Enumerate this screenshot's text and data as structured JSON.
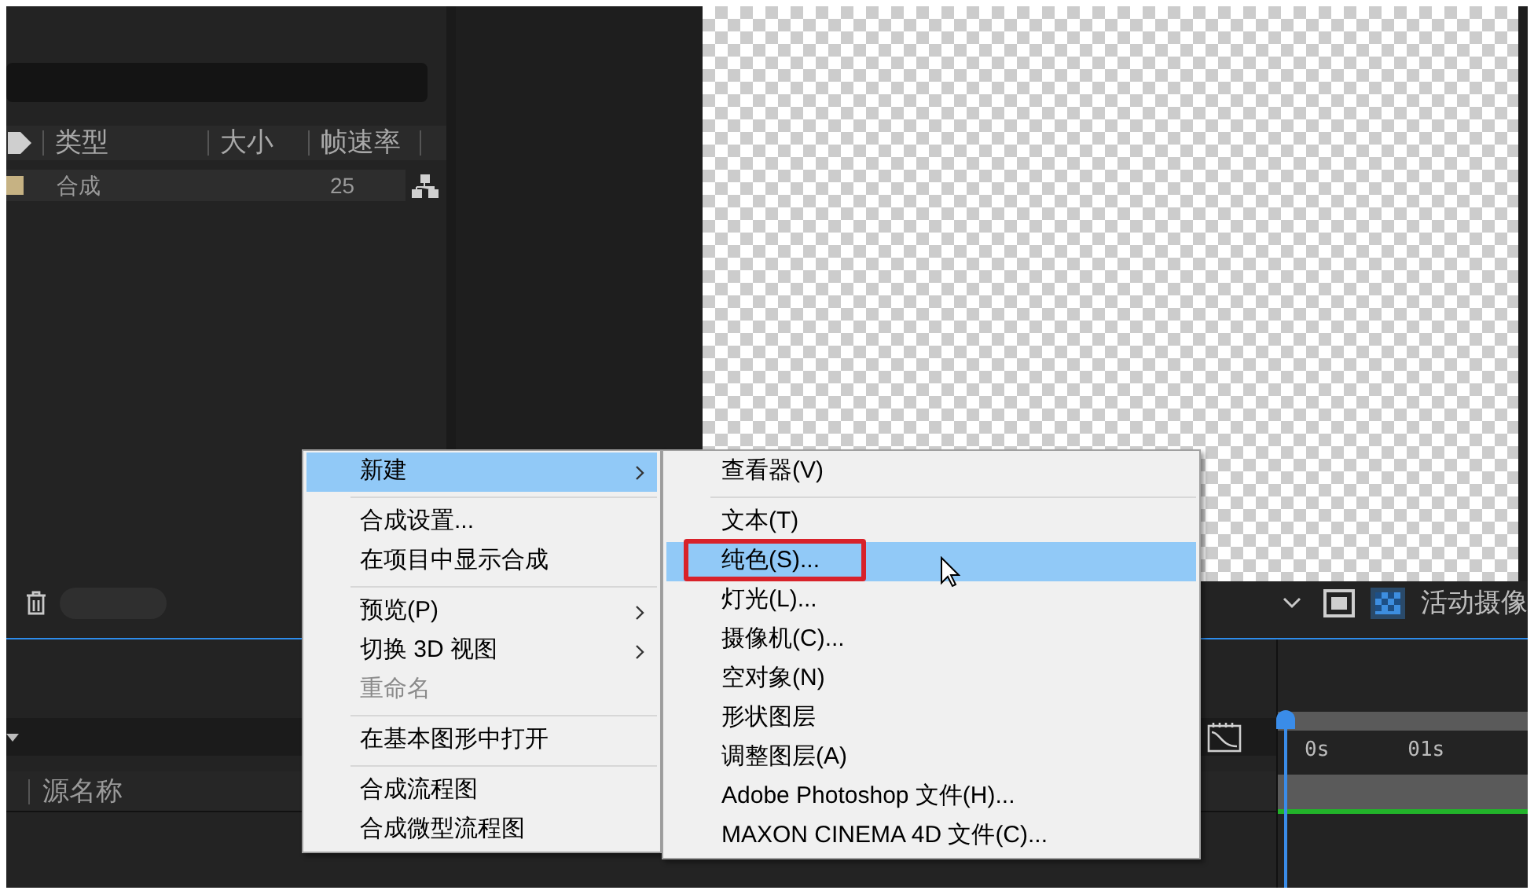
{
  "project_panel": {
    "columns": [
      {
        "label": "类型"
      },
      {
        "label": "大小"
      },
      {
        "label": "帧速率"
      }
    ],
    "rows": [
      {
        "type": "合成",
        "frame_rate": "25",
        "color": "#c6b283"
      }
    ]
  },
  "viewer_toolbar": {
    "camera_label": "活动摄像"
  },
  "timeline": {
    "column": "源名称",
    "ruler": [
      "0s",
      "01s"
    ]
  },
  "context_menu": {
    "items": [
      {
        "kind": "item",
        "label": "新建",
        "submenu": true,
        "selected": true,
        "disabled": false
      },
      {
        "kind": "separator"
      },
      {
        "kind": "item",
        "label": "合成设置...",
        "submenu": false,
        "selected": false,
        "disabled": false
      },
      {
        "kind": "item",
        "label": "在项目中显示合成",
        "submenu": false,
        "selected": false,
        "disabled": false
      },
      {
        "kind": "separator"
      },
      {
        "kind": "item",
        "label": "预览(P)",
        "submenu": true,
        "selected": false,
        "disabled": false
      },
      {
        "kind": "item",
        "label": "切换 3D 视图",
        "submenu": true,
        "selected": false,
        "disabled": false
      },
      {
        "kind": "item",
        "label": "重命名",
        "submenu": false,
        "selected": false,
        "disabled": true
      },
      {
        "kind": "separator"
      },
      {
        "kind": "item",
        "label": "在基本图形中打开",
        "submenu": false,
        "selected": false,
        "disabled": false
      },
      {
        "kind": "separator"
      },
      {
        "kind": "item",
        "label": "合成流程图",
        "submenu": false,
        "selected": false,
        "disabled": false
      },
      {
        "kind": "item",
        "label": "合成微型流程图",
        "submenu": false,
        "selected": false,
        "disabled": false
      }
    ]
  },
  "submenu": {
    "items": [
      {
        "kind": "item",
        "label": "查看器(V)",
        "selected": false,
        "annotated": false
      },
      {
        "kind": "separator"
      },
      {
        "kind": "item",
        "label": "文本(T)",
        "selected": false,
        "annotated": false
      },
      {
        "kind": "item",
        "label": "纯色(S)...",
        "selected": true,
        "annotated": true
      },
      {
        "kind": "item",
        "label": "灯光(L)...",
        "selected": false,
        "annotated": false
      },
      {
        "kind": "item",
        "label": "摄像机(C)...",
        "selected": false,
        "annotated": false
      },
      {
        "kind": "item",
        "label": "空对象(N)",
        "selected": false,
        "annotated": false
      },
      {
        "kind": "item",
        "label": "形状图层",
        "selected": false,
        "annotated": false
      },
      {
        "kind": "item",
        "label": "调整图层(A)",
        "selected": false,
        "annotated": false
      },
      {
        "kind": "item",
        "label": "Adobe Photoshop 文件(H)...",
        "selected": false,
        "annotated": false
      },
      {
        "kind": "item",
        "label": "MAXON CINEMA 4D 文件(C)...",
        "selected": false,
        "annotated": false
      }
    ]
  }
}
